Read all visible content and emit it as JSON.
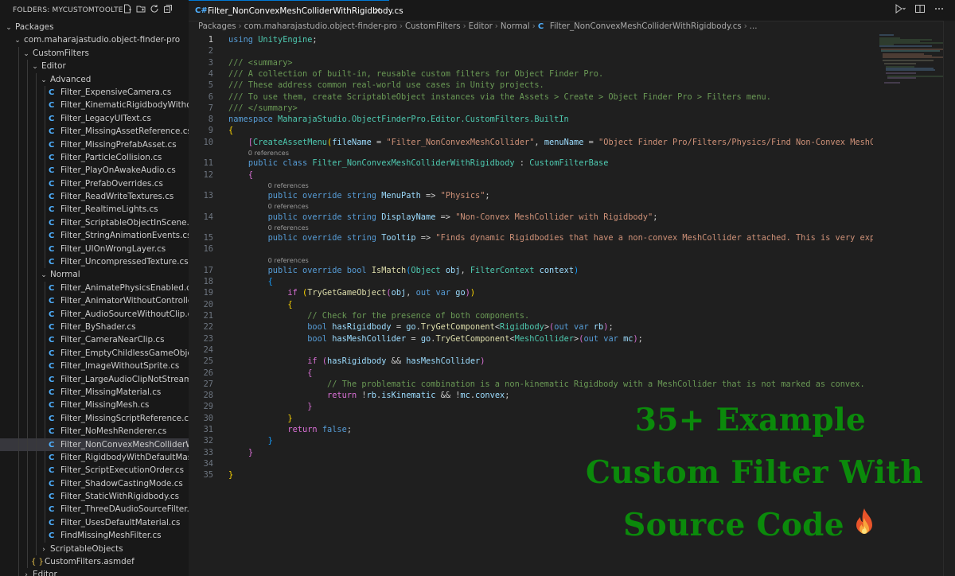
{
  "sidebar": {
    "title": "FOLDERS: MYCUSTOMTOOLTESTER_...",
    "actions": [
      "new-file-icon",
      "new-folder-icon",
      "refresh-icon",
      "collapse-all-icon"
    ],
    "packages": "Packages",
    "package": "com.maharajastudio.object-finder-pro",
    "custom_filters": "CustomFilters",
    "editor": "Editor",
    "advanced": "Advanced",
    "advanced_files": [
      "Filter_ExpensiveCamera.cs",
      "Filter_KinematicRigidbodyWithoutCollid...",
      "Filter_LegacyUIText.cs",
      "Filter_MissingAssetReference.cs",
      "Filter_MissingPrefabAsset.cs",
      "Filter_ParticleCollision.cs",
      "Filter_PlayOnAwakeAudio.cs",
      "Filter_PrefabOverrides.cs",
      "Filter_ReadWriteTextures.cs",
      "Filter_RealtimeLights.cs",
      "Filter_ScriptableObjectInScene.cs",
      "Filter_StringAnimationEvents.cs",
      "Filter_UIOnWrongLayer.cs",
      "Filter_UncompressedTexture.cs"
    ],
    "normal": "Normal",
    "normal_files": [
      "Filter_AnimatePhysicsEnabled.cs",
      "Filter_AnimatorWithoutController.cs",
      "Filter_AudioSourceWithoutClip.cs",
      "Filter_ByShader.cs",
      "Filter_CameraNearClip.cs",
      "Filter_EmptyChildlessGameObject.cs",
      "Filter_ImageWithoutSprite.cs",
      "Filter_LargeAudioClipNotStreaming.cs",
      "Filter_MissingMaterial.cs",
      "Filter_MissingMesh.cs",
      "Filter_MissingScriptReference.cs",
      "Filter_NoMeshRenderer.cs",
      "Filter_NonConvexMeshColliderWithRigid...",
      "Filter_RigidbodyWithDefaultMass.cs",
      "Filter_ScriptExecutionOrder.cs",
      "Filter_ShadowCastingMode.cs",
      "Filter_StaticWithRigidbody.cs",
      "Filter_ThreeDAudioSourceFilter.cs",
      "Filter_UsesDefaultMaterial.cs",
      "FindMissingMeshFilter.cs"
    ],
    "selected_file": "Filter_NonConvexMeshColliderWithRigid...",
    "scriptable_objects": "ScriptableObjects",
    "asmdef": "CustomFilters.asmdef",
    "editor2": "Editor"
  },
  "tab": {
    "title": "Filter_NonConvexMeshColliderWithRigidbody.cs",
    "close_glyph": "✕",
    "actions": [
      "run-icon",
      "split-editor-icon",
      "more-actions-icon"
    ]
  },
  "breadcrumb": [
    "Packages",
    "com.maharajastudio.object-finder-pro",
    "CustomFilters",
    "Editor",
    "Normal",
    "Filter_NonConvexMeshColliderWithRigidbody.cs",
    "..."
  ],
  "code": {
    "active_line": 1,
    "codelens_label": "0 references",
    "line_numbers": [
      "1",
      "2",
      "3",
      "4",
      "5",
      "6",
      "7",
      "8",
      "9",
      "10",
      "11",
      "12",
      "13",
      "14",
      "15",
      "16",
      "17",
      "18",
      "19",
      "20",
      "21",
      "22",
      "23",
      "24",
      "25",
      "26",
      "27",
      "28",
      "29",
      "30",
      "31",
      "32",
      "33",
      "34",
      "35"
    ],
    "lines": [
      [
        [
          "k",
          "using"
        ],
        [
          "",
          " "
        ],
        [
          "t",
          "UnityEngine"
        ],
        [
          "",
          ";"
        ]
      ],
      [],
      [
        [
          "c",
          "/// <summary>"
        ]
      ],
      [
        [
          "c",
          "/// A collection of built-in, reusable custom filters for Object Finder Pro."
        ]
      ],
      [
        [
          "c",
          "/// These address common real-world use cases in Unity projects."
        ]
      ],
      [
        [
          "c",
          "/// To use them, create ScriptableObject instances via the Assets > Create > Object Finder Pro > Filters menu."
        ]
      ],
      [
        [
          "c",
          "/// </summary>"
        ]
      ],
      [
        [
          "k",
          "namespace"
        ],
        [
          "",
          " "
        ],
        [
          "t",
          "MaharajaStudio.ObjectFinderPro.Editor.CustomFilters.BuiltIn"
        ]
      ],
      [
        [
          "y",
          "{"
        ]
      ],
      [
        [
          "",
          "    "
        ],
        [
          "p",
          "["
        ],
        [
          "t",
          "CreateAssetMenu"
        ],
        [
          "y",
          "("
        ],
        [
          "v",
          "fileName"
        ],
        [
          "",
          " = "
        ],
        [
          "s",
          "\"Filter_NonConvexMeshCollider\""
        ],
        [
          "",
          ", "
        ],
        [
          "v",
          "menuName"
        ],
        [
          "",
          " = "
        ],
        [
          "s",
          "\"Object Finder Pro/Filters/Physics/Find Non-Convex MeshColliders w"
        ]
      ],
      [
        [
          "",
          "    "
        ],
        [
          "k",
          "public class"
        ],
        [
          "",
          " "
        ],
        [
          "t",
          "Filter_NonConvexMeshColliderWithRigidbody"
        ],
        [
          "",
          " : "
        ],
        [
          "t",
          "CustomFilterBase"
        ]
      ],
      [
        [
          "",
          "    "
        ],
        [
          "p",
          "{"
        ]
      ],
      [
        [
          "",
          "        "
        ],
        [
          "k",
          "public override string"
        ],
        [
          "",
          " "
        ],
        [
          "v",
          "MenuPath"
        ],
        [
          "",
          " => "
        ],
        [
          "s",
          "\"Physics\""
        ],
        [
          "",
          ";"
        ]
      ],
      [
        [
          "",
          "        "
        ],
        [
          "k",
          "public override string"
        ],
        [
          "",
          " "
        ],
        [
          "v",
          "DisplayName"
        ],
        [
          "",
          " => "
        ],
        [
          "s",
          "\"Non-Convex MeshCollider with Rigidbody\""
        ],
        [
          "",
          ";"
        ]
      ],
      [
        [
          "",
          "        "
        ],
        [
          "k",
          "public override string"
        ],
        [
          "",
          " "
        ],
        [
          "v",
          "Tooltip"
        ],
        [
          "",
          " => "
        ],
        [
          "s",
          "\"Finds dynamic Rigidbodies that have a non-convex MeshCollider attached. This is very expensive and"
        ]
      ],
      [],
      [
        [
          "",
          "        "
        ],
        [
          "k",
          "public override bool"
        ],
        [
          "",
          " "
        ],
        [
          "f",
          "IsMatch"
        ],
        [
          "b",
          "("
        ],
        [
          "t",
          "Object"
        ],
        [
          "",
          " "
        ],
        [
          "v",
          "obj"
        ],
        [
          "",
          ", "
        ],
        [
          "t",
          "FilterContext"
        ],
        [
          "",
          " "
        ],
        [
          "v",
          "context"
        ],
        [
          "b",
          ")"
        ]
      ],
      [
        [
          "",
          "        "
        ],
        [
          "b",
          "{"
        ]
      ],
      [
        [
          "",
          "            "
        ],
        [
          "p",
          "if"
        ],
        [
          "",
          ""
        ],
        [
          "",
          " "
        ],
        [
          "y",
          "("
        ],
        [
          "f",
          "TryGetGameObject"
        ],
        [
          "p",
          "("
        ],
        [
          "v",
          "obj"
        ],
        [
          "",
          ", "
        ],
        [
          "k",
          "out var"
        ],
        [
          "",
          " "
        ],
        [
          "v",
          "go"
        ],
        [
          "p",
          ")"
        ],
        [
          "y",
          ")"
        ]
      ],
      [
        [
          "",
          "            "
        ],
        [
          "y",
          "{"
        ]
      ],
      [
        [
          "",
          "                "
        ],
        [
          "c",
          "// Check for the presence of both components."
        ]
      ],
      [
        [
          "",
          "                "
        ],
        [
          "k",
          "bool"
        ],
        [
          "",
          " "
        ],
        [
          "v",
          "hasRigidbody"
        ],
        [
          "",
          " = "
        ],
        [
          "v",
          "go"
        ],
        [
          "",
          "."
        ],
        [
          "f",
          "TryGetComponent"
        ],
        [
          "",
          ""
        ],
        [
          "",
          "<"
        ],
        [
          "t",
          "Rigidbody"
        ],
        [
          "",
          ">"
        ],
        [
          "p",
          "("
        ],
        [
          "k",
          "out var"
        ],
        [
          "",
          " "
        ],
        [
          "v",
          "rb"
        ],
        [
          "p",
          ")"
        ],
        [
          "",
          ";"
        ]
      ],
      [
        [
          "",
          "                "
        ],
        [
          "k",
          "bool"
        ],
        [
          "",
          " "
        ],
        [
          "v",
          "hasMeshCollider"
        ],
        [
          "",
          " = "
        ],
        [
          "v",
          "go"
        ],
        [
          "",
          "."
        ],
        [
          "f",
          "TryGetComponent"
        ],
        [
          "",
          "<"
        ],
        [
          "t",
          "MeshCollider"
        ],
        [
          "",
          ">"
        ],
        [
          "p",
          "("
        ],
        [
          "k",
          "out var"
        ],
        [
          "",
          " "
        ],
        [
          "v",
          "mc"
        ],
        [
          "p",
          ")"
        ],
        [
          "",
          ";"
        ]
      ],
      [],
      [
        [
          "",
          "                "
        ],
        [
          "p",
          "if"
        ],
        [
          "",
          " "
        ],
        [
          "p",
          "("
        ],
        [
          "v",
          "hasRigidbody"
        ],
        [
          "",
          " && "
        ],
        [
          "v",
          "hasMeshCollider"
        ],
        [
          "p",
          ")"
        ]
      ],
      [
        [
          "",
          "                "
        ],
        [
          "p",
          "{"
        ]
      ],
      [
        [
          "",
          "                    "
        ],
        [
          "c",
          "// The problematic combination is a non-kinematic Rigidbody with a MeshCollider that is not marked as convex."
        ]
      ],
      [
        [
          "",
          "                    "
        ],
        [
          "p",
          "return"
        ],
        [
          "",
          " !"
        ],
        [
          "v",
          "rb"
        ],
        [
          "",
          "."
        ],
        [
          "v",
          "isKinematic"
        ],
        [
          "",
          " && !"
        ],
        [
          "v",
          "mc"
        ],
        [
          "",
          "."
        ],
        [
          "v",
          "convex"
        ],
        [
          "",
          ";"
        ]
      ],
      [
        [
          "",
          "                "
        ],
        [
          "p",
          "}"
        ]
      ],
      [
        [
          "",
          "            "
        ],
        [
          "y",
          "}"
        ]
      ],
      [
        [
          "",
          "            "
        ],
        [
          "p",
          "return"
        ],
        [
          "",
          " "
        ],
        [
          "k",
          "false"
        ],
        [
          "",
          ";"
        ]
      ],
      [
        [
          "",
          "        "
        ],
        [
          "b",
          "}"
        ]
      ],
      [
        [
          "",
          "    "
        ],
        [
          "p",
          "}"
        ]
      ],
      [],
      [
        [
          "y",
          "}"
        ]
      ]
    ]
  },
  "promo": {
    "line1": "35+ Example",
    "line2": "Custom Filter With",
    "line3": "Source Code"
  },
  "colors": {
    "accent": "#0078d4",
    "promo_green": "#0b8a0b",
    "selection": "#37373d"
  }
}
